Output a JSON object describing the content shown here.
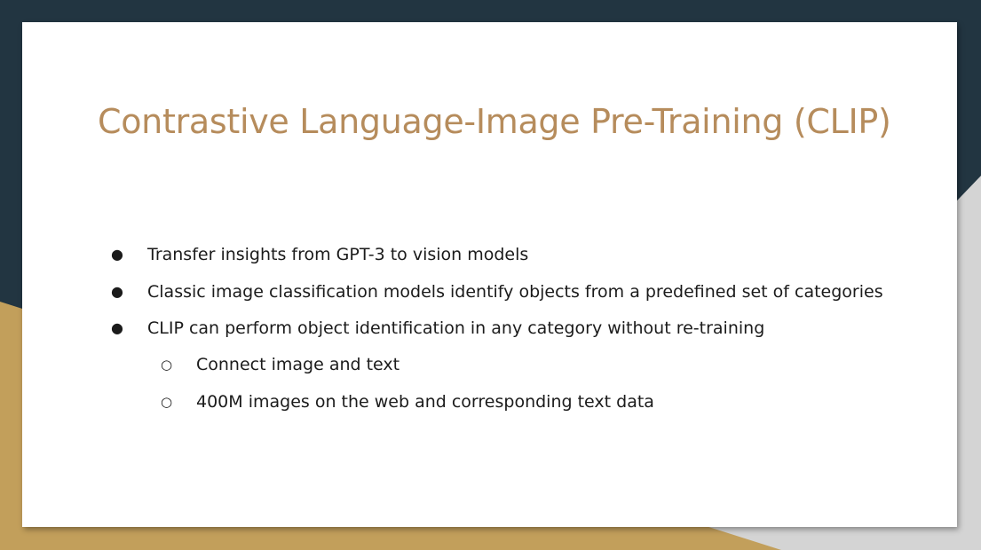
{
  "colors": {
    "navy": "#223541",
    "gold": "#c29f5b",
    "grey": "#d4d4d4",
    "title": "#b68c5c",
    "text": "#1b1b1b"
  },
  "slide": {
    "title": "Contrastive Language-Image Pre-Training (CLIP)",
    "bullets": [
      {
        "level": 1,
        "marker": "●",
        "text": "Transfer insights from GPT-3 to vision models"
      },
      {
        "level": 1,
        "marker": "●",
        "text": "Classic image classification models identify objects from a predefined set of categories"
      },
      {
        "level": 1,
        "marker": "●",
        "text": "CLIP can perform object identification in any category without re-training"
      },
      {
        "level": 2,
        "marker": "○",
        "text": "Connect image and text"
      },
      {
        "level": 2,
        "marker": "○",
        "text": "400M images on the web and corresponding text data"
      }
    ]
  }
}
